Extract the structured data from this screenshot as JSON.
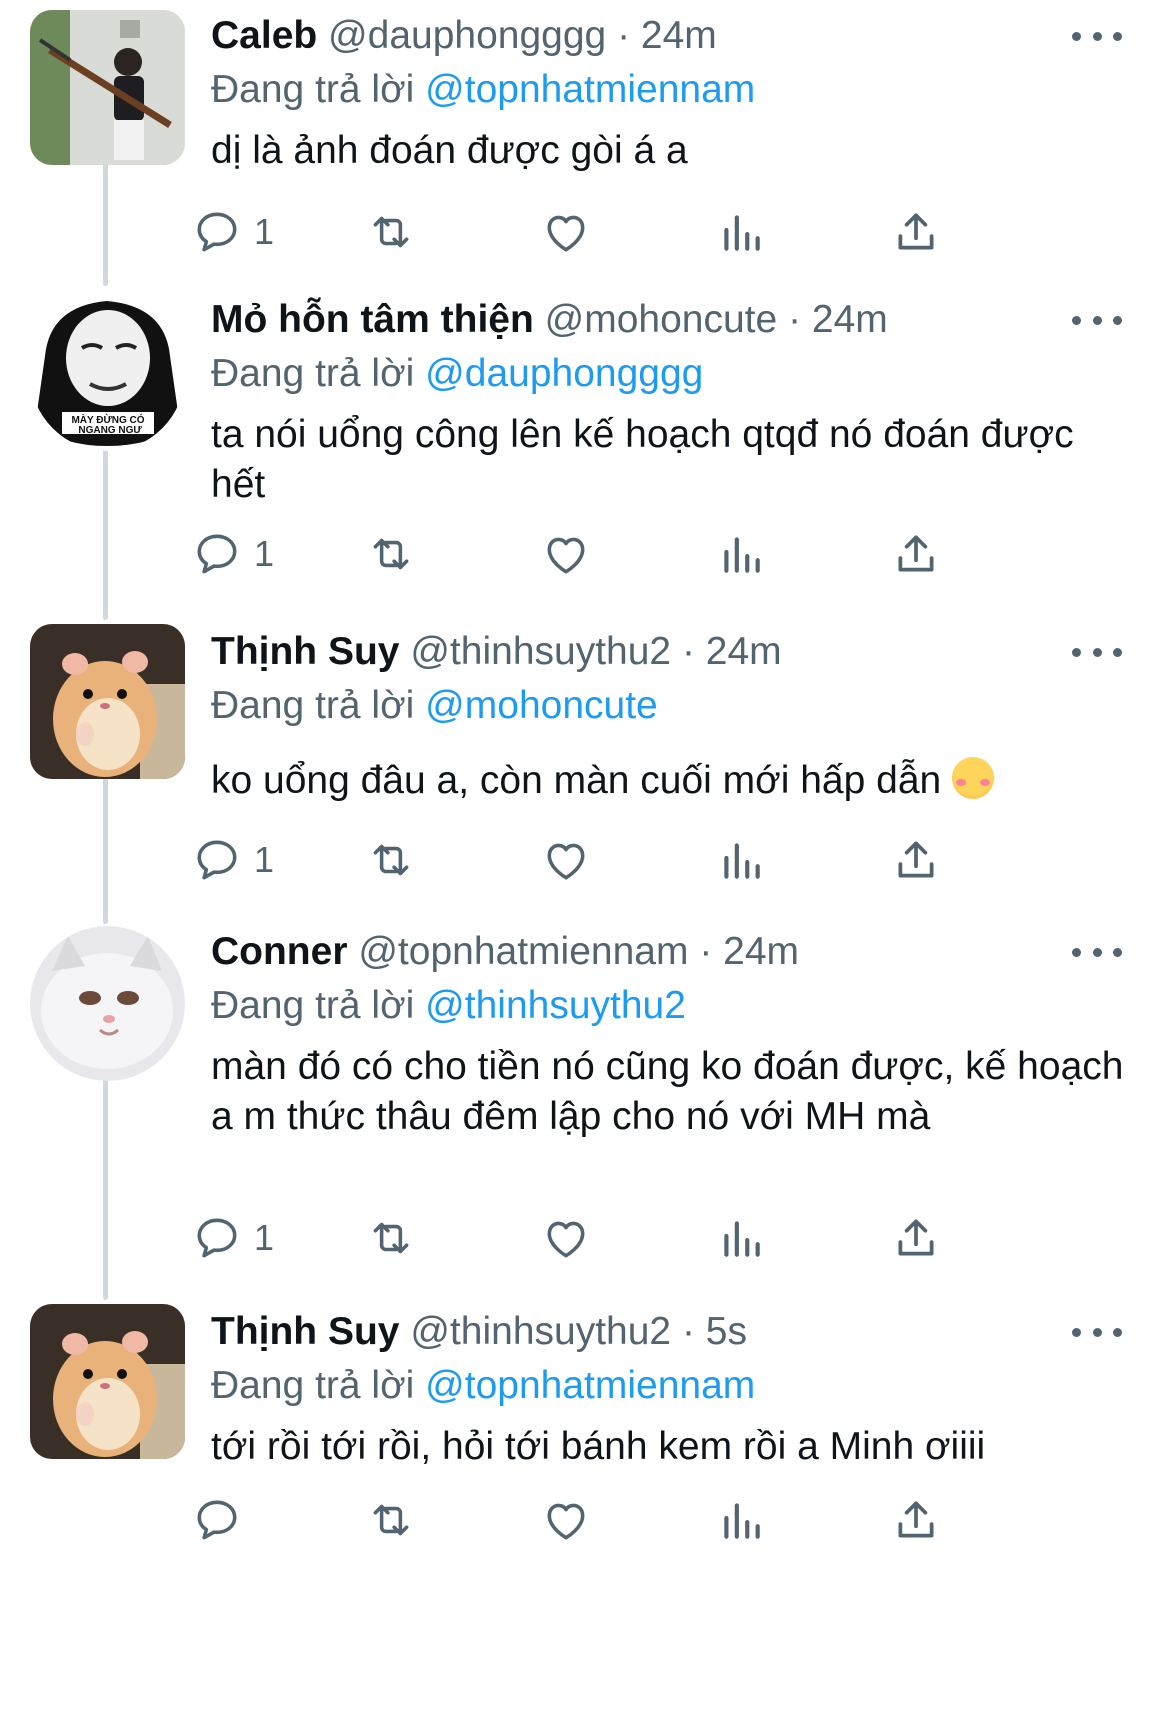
{
  "tweets": [
    {
      "name": "Caleb",
      "handle": "@dauphongggg",
      "separator": "·",
      "time": "24m",
      "reply_prefix": "Đang trả lời",
      "reply_to": "@topnhatmiennam",
      "text": "dị là ảnh đoán được gòi á a",
      "reply_count": "1"
    },
    {
      "name": "Mỏ hỗn tâm thiện",
      "handle": "@mohoncute",
      "separator": "·",
      "time": "24m",
      "reply_prefix": "Đang trả lời",
      "reply_to": "@dauphongggg",
      "text": "ta nói uổng công lên kế hoạch qtqđ nó đoán được hết",
      "avatar_caption": "MÀY ĐỪNG CÓ NGANG NGƯ",
      "reply_count": "1"
    },
    {
      "name": "Thịnh Suy",
      "handle": "@thinhsuythu2",
      "separator": "·",
      "time": "24m",
      "reply_prefix": "Đang trả lời",
      "reply_to": "@mohoncute",
      "text": "ko uổng đâu a, còn màn cuối mới hấp dẫn",
      "text_emoji": "smiling-face-with-hearts",
      "reply_count": "1"
    },
    {
      "name": "Conner",
      "handle": "@topnhatmiennam",
      "separator": "·",
      "time": "24m",
      "reply_prefix": "Đang trả lời",
      "reply_to": "@thinhsuythu2",
      "text": "màn đó có cho tiền nó cũng ko đoán được, kế hoạch a m thức thâu đêm lập cho nó với MH mà",
      "reply_count": "1"
    },
    {
      "name": "Thịnh Suy",
      "handle": "@thinhsuythu2",
      "separator": "·",
      "time": "5s",
      "reply_prefix": "Đang trả lời",
      "reply_to": "@topnhatmiennam",
      "text": "tới rồi tới rồi, hỏi tới bánh kem rồi a Minh ơiiii",
      "reply_count": ""
    }
  ],
  "icons": {
    "reply": "comment-icon",
    "retweet": "retweet-icon",
    "like": "heart-icon",
    "analytics": "analytics-icon",
    "share": "share-icon",
    "more": "more-dots-icon"
  },
  "colors": {
    "link": "#1d9bf0",
    "secondary_text": "#536471",
    "primary_text": "#0f1419",
    "thread_line": "#cfd9de"
  }
}
